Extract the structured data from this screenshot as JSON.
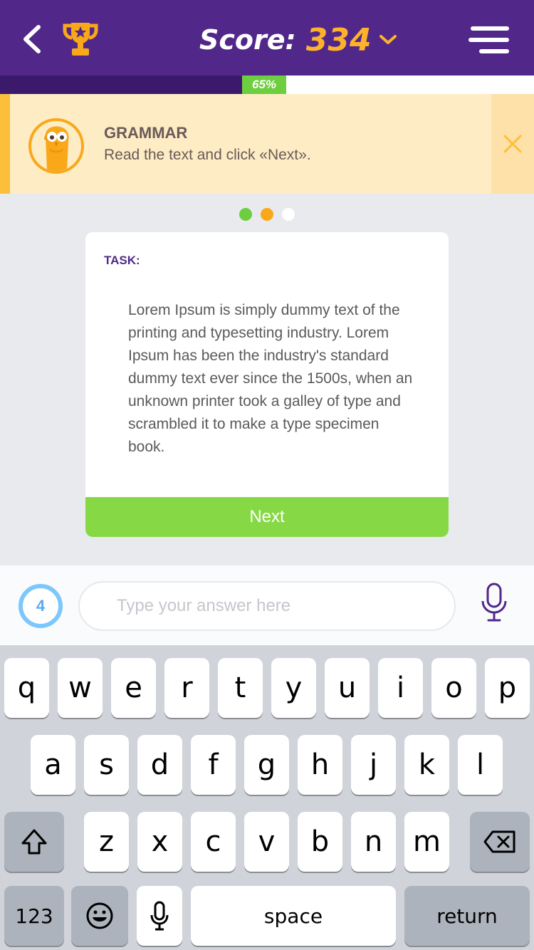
{
  "header": {
    "back_icon": "chevron-left-icon",
    "trophy_icon": "trophy-icon",
    "score_label": "Score:",
    "score_value": "334",
    "menu_icon": "hamburger-menu-icon"
  },
  "progress": {
    "percent": 65,
    "label": "65%"
  },
  "hint": {
    "title": "GRAMMAR",
    "text": "Read the text and click «Next».",
    "close_icon": "close-icon"
  },
  "pager": {
    "total": 3,
    "colors": [
      "#6dce3f",
      "#f9a81a",
      "#ffffff"
    ]
  },
  "task": {
    "label": "TASK:",
    "text": "Lorem Ipsum is simply dummy text of the printing and typesetting industry. Lorem Ipsum has been the industry's standard dummy text ever since the 1500s, when an unknown printer took a galley of type and scrambled it to make a type specimen book.",
    "next_label": "Next"
  },
  "answer": {
    "attempts": "4",
    "placeholder": "Type your answer here",
    "value": ""
  },
  "keyboard": {
    "row1": [
      "q",
      "w",
      "e",
      "r",
      "t",
      "y",
      "u",
      "i",
      "o",
      "p"
    ],
    "row2": [
      "a",
      "s",
      "d",
      "f",
      "g",
      "h",
      "j",
      "k",
      "l"
    ],
    "row3": [
      "z",
      "x",
      "c",
      "v",
      "b",
      "n",
      "m"
    ],
    "numbers_label": "123",
    "space_label": "space",
    "return_label": "return"
  },
  "colors": {
    "header_bg": "#51288a",
    "score_accent": "#fdb22d",
    "progress_green": "#6dce3f",
    "hint_bg": "#fdecc4",
    "next_green": "#86d945",
    "attempts_blue": "#7cc7fb"
  }
}
